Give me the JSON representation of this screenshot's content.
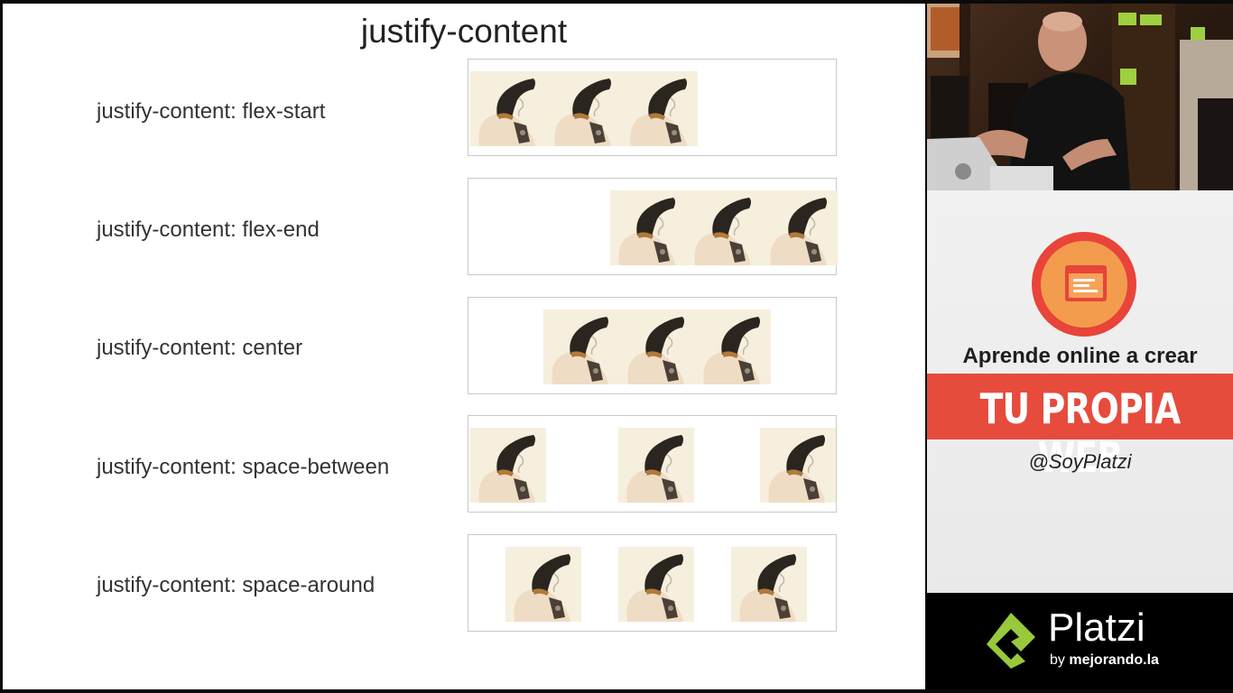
{
  "slide": {
    "title": "justify-content",
    "rows": [
      {
        "label": "justify-content: flex-start"
      },
      {
        "label": "justify-content: flex-end"
      },
      {
        "label": "justify-content: center"
      },
      {
        "label": "justify-content: space-between"
      },
      {
        "label": "justify-content: space-around"
      }
    ]
  },
  "sidebar": {
    "ad": {
      "line1": "Aprende online a crear",
      "banner": "TU PROPIA WEB",
      "handle": "@SoyPlatzi",
      "icon": "browser-window-icon"
    },
    "brand": {
      "name": "Platzi",
      "by": "by",
      "by_name": "mejorando.la",
      "logo_icon": "platzi-logo-icon"
    }
  },
  "colors": {
    "banner": "#e64b3c",
    "brand_green": "#98c93c",
    "circle_outer": "#e8443a",
    "circle_inner": "#f39c4d"
  }
}
